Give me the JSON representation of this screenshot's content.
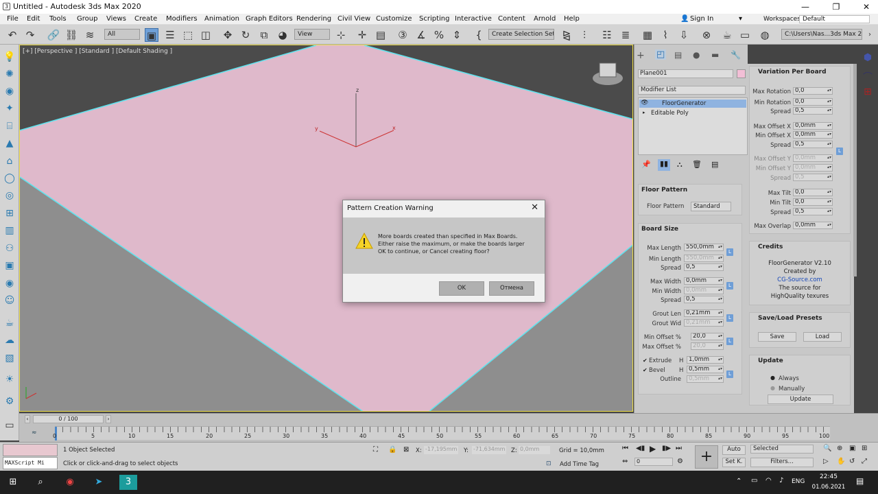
{
  "window": {
    "title": "Untitled - Autodesk 3ds Max 2020",
    "minimize": "—",
    "restore": "❐",
    "close": "✕"
  },
  "menubar": {
    "items": [
      "File",
      "Edit",
      "Tools",
      "Group",
      "Views",
      "Create",
      "Modifiers",
      "Animation",
      "Graph Editors",
      "Rendering",
      "Civil View",
      "Customize",
      "Scripting",
      "Interactive",
      "Content",
      "Arnold",
      "Help"
    ],
    "sign_in": "Sign In",
    "workspaces_label": "Workspaces:",
    "workspace_value": "Default"
  },
  "toolbar": {
    "filter_value": "All",
    "view_value": "View",
    "selection_set": "Create Selection Set",
    "path": "C:\\Users\\Nas...3ds Max 2020"
  },
  "viewport": {
    "label": "[+] [Perspective ] [Standard ] [Default Shading ]",
    "axis_x": "x",
    "axis_y": "y",
    "axis_z": "z"
  },
  "command_panel": {
    "object_name": "Plane001",
    "modifier_list": "Modifier List",
    "stack": [
      "FloorGenerator",
      "Editable Poly"
    ],
    "floor_pattern": {
      "title": "Floor Pattern",
      "label": "Floor Pattern",
      "value": "Standard"
    },
    "board_size": {
      "title": "Board Size",
      "max_length_label": "Max Length",
      "max_length": "550,0mm",
      "min_length_label": "Min Length",
      "min_length": "550,0mm",
      "spread1_label": "Spread",
      "spread1": "0,5",
      "max_width_label": "Max Width",
      "max_width": "0,0mm",
      "min_width_label": "Min Width",
      "min_width": "0,0mm",
      "spread2_label": "Spread",
      "spread2": "0,5",
      "grout_len_label": "Grout Len",
      "grout_len": "0,21mm",
      "grout_wid_label": "Grout Wid",
      "grout_wid": "0,21mm",
      "min_offset_label": "Min Offset %",
      "min_offset": "20,0",
      "max_offset_label": "Max Offset %",
      "max_offset": "20,0",
      "extrude_label": "Extrude",
      "extrude_h": "H",
      "extrude": "1,0mm",
      "bevel_label": "Bevel",
      "bevel_h": "H",
      "bevel": "0,5mm",
      "outline_label": "Outline",
      "outline": "0,5mm",
      "l": "L"
    }
  },
  "right_panel": {
    "variation": {
      "title": "Variation Per Board",
      "max_rot_label": "Max Rotation",
      "max_rot": "0,0",
      "min_rot_label": "Min Rotation",
      "min_rot": "0,0",
      "spread_a_label": "Spread",
      "spread_a": "0,5",
      "max_off_x_label": "Max Offset X",
      "max_off_x": "0,0mm",
      "min_off_x_label": "Min Offset X",
      "min_off_x": "0,0mm",
      "spread_b_label": "Spread",
      "spread_b": "0,5",
      "max_off_y_label": "Max Offset Y",
      "max_off_y": "0,0mm",
      "min_off_y_label": "Min Offset Y",
      "min_off_y": "0,0mm",
      "spread_c_label": "Spread",
      "spread_c": "0,5",
      "max_tilt_label": "Max Tilt",
      "max_tilt": "0,0",
      "min_tilt_label": "Min Tilt",
      "min_tilt": "0,0",
      "spread_d_label": "Spread",
      "spread_d": "0,5",
      "max_overlap_label": "Max Overlap",
      "max_overlap": "0,0mm"
    },
    "credits": {
      "title": "Credits",
      "lines": [
        "FloorGenerator V2.10",
        "Created by",
        "CG-Source.com",
        "The source for",
        "HighQuality texures"
      ]
    },
    "save_load": {
      "title": "Save/Load Presets",
      "save": "Save",
      "load": "Load"
    },
    "update": {
      "title": "Update",
      "always": "Always",
      "manually": "Manually",
      "button": "Update"
    }
  },
  "timeline": {
    "frame": "0 / 100",
    "ticks": [
      "0",
      "5",
      "10",
      "15",
      "20",
      "25",
      "30",
      "35",
      "40",
      "45",
      "50",
      "55",
      "60",
      "65",
      "70",
      "75",
      "80",
      "85",
      "90",
      "95",
      "100"
    ]
  },
  "status": {
    "maxscript": "MAXScript Mi",
    "selected": "1 Object Selected",
    "hint": "Click or click-and-drag to select objects",
    "x_label": "X:",
    "x": "-17,195mm",
    "y_label": "Y:",
    "y": "-71,634mm",
    "z_label": "Z:",
    "z": "0,0mm",
    "grid": "Grid = 10,0mm",
    "add_time_tag": "Add Time Tag",
    "auto": "Auto",
    "set_k": "Set K.",
    "selected_dd": "Selected",
    "filters": "Filters...",
    "frame_field": "0"
  },
  "dialog": {
    "title": "Pattern Creation Warning",
    "close": "✕",
    "lines": [
      "More boards created than specified in Max Boards.",
      "Either raise the maximum, or make the boards larger",
      "OK to continue, or Cancel creating floor?"
    ],
    "ok": "OK",
    "cancel": "Отмена"
  },
  "taskbar": {
    "time": "22:45",
    "date": "01.06.2021",
    "lang": "ENG"
  }
}
